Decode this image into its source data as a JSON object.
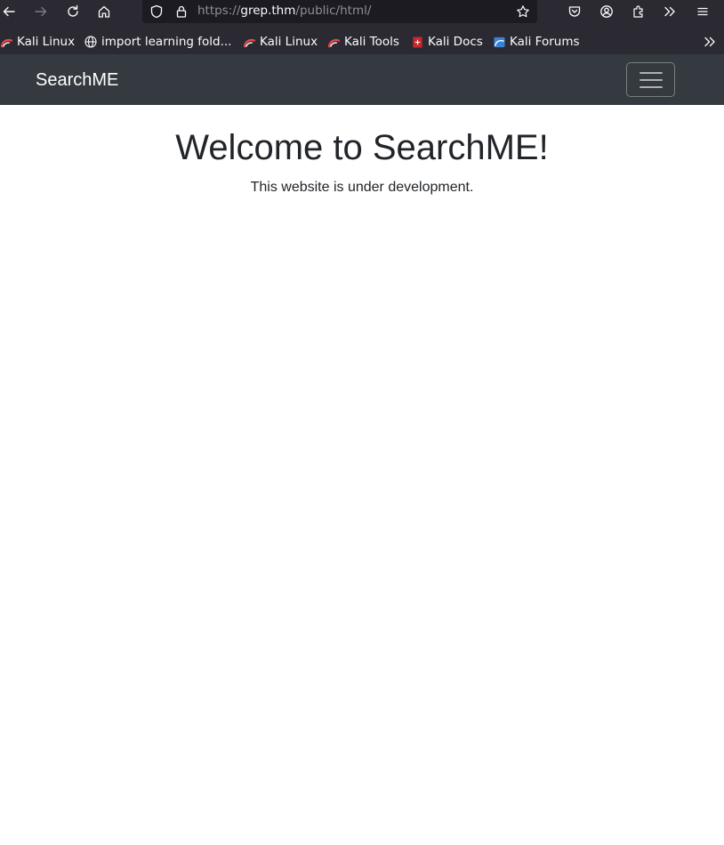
{
  "browser": {
    "url_scheme": "https://",
    "url_host": "grep.thm",
    "url_path": "/public/html/",
    "icons": [
      "back-icon",
      "forward-icon",
      "reload-icon",
      "home-icon",
      "shield-icon",
      "lock-icon",
      "star-icon",
      "pocket-icon",
      "account-icon",
      "extensions-icon",
      "overflow-icon",
      "menu-icon"
    ]
  },
  "bookmarks": [
    {
      "label": "Kali Linux",
      "icon": "kali-favicon"
    },
    {
      "label": "import learning fold...",
      "icon": "globe-icon"
    },
    {
      "label": "Kali Linux",
      "icon": "kali-favicon"
    },
    {
      "label": "Kali Tools",
      "icon": "kali-favicon"
    },
    {
      "label": "Kali Docs",
      "icon": "kali-docs-favicon"
    },
    {
      "label": "Kali Forums",
      "icon": "kali-forums-favicon"
    }
  ],
  "navbar": {
    "brand": "SearchME"
  },
  "main": {
    "heading": "Welcome to SearchME!",
    "subtitle": "This website is under development."
  },
  "colors": {
    "navbar_bg": "#343a40",
    "browser_bg": "#2b2a33",
    "urlbar_bg": "#1c1b22",
    "text": "#212529"
  }
}
